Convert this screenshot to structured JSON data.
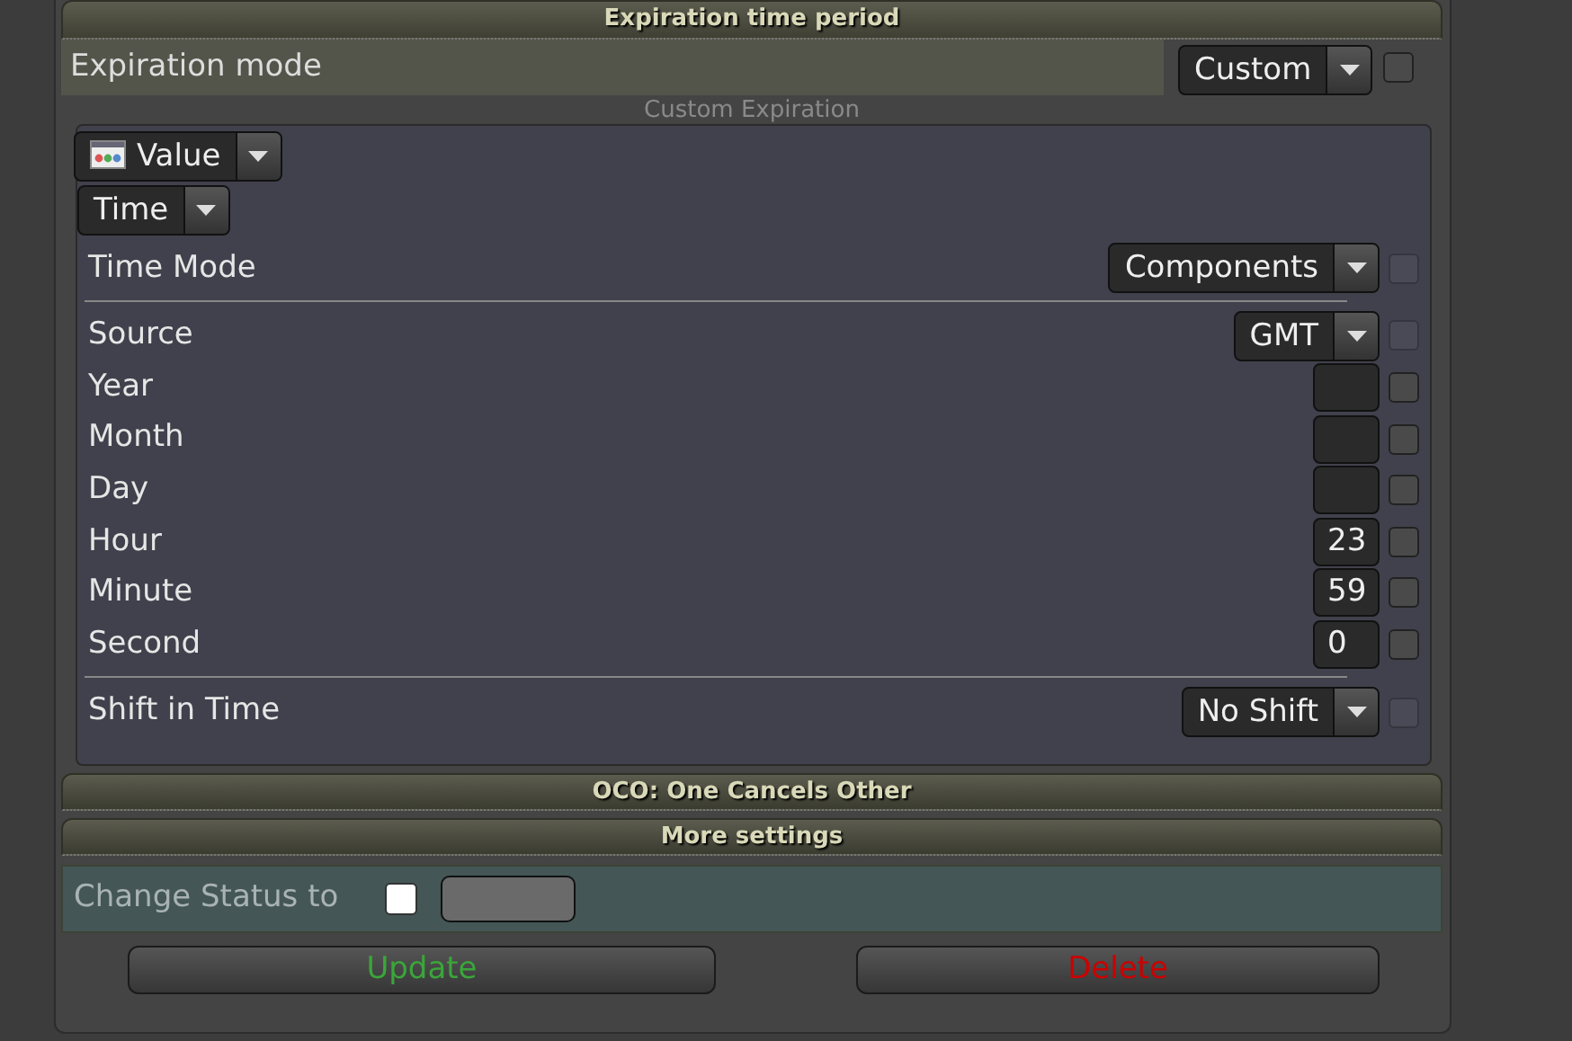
{
  "section_header": "Expiration time period",
  "expiration_mode": {
    "label": "Expiration mode",
    "value": "Custom",
    "checkbox": {
      "checked": false,
      "disabled": false
    }
  },
  "custom_expiration": {
    "caption": "Custom Expiration",
    "value_select": "Value",
    "type_select": "Time",
    "groups": [
      [
        {
          "kind": "select",
          "label": "Time Mode",
          "value": "Components",
          "checkbox": {
            "checked": false,
            "disabled": true
          }
        }
      ],
      [
        {
          "kind": "select",
          "label": "Source",
          "value": "GMT",
          "checkbox": {
            "checked": false,
            "disabled": true
          }
        },
        {
          "kind": "number",
          "label": "Year",
          "checkbox": {
            "checked": false,
            "disabled": false
          }
        },
        {
          "kind": "number",
          "label": "Month",
          "checkbox": {
            "checked": false,
            "disabled": false
          }
        },
        {
          "kind": "number",
          "label": "Day",
          "checkbox": {
            "checked": false,
            "disabled": false
          }
        },
        {
          "kind": "number",
          "label": "Hour",
          "value": "23",
          "checkbox": {
            "checked": false,
            "disabled": false
          }
        },
        {
          "kind": "number",
          "label": "Minute",
          "value": "59",
          "checkbox": {
            "checked": false,
            "disabled": false
          }
        },
        {
          "kind": "number",
          "label": "Second",
          "value": "0",
          "checkbox": {
            "checked": false,
            "disabled": false
          }
        }
      ],
      [
        {
          "kind": "select",
          "label": "Shift in Time",
          "value": "No Shift",
          "checkbox": {
            "checked": false,
            "disabled": true
          }
        }
      ]
    ]
  },
  "collapsed_sections": [
    "OCO: One Cancels Other",
    "More settings"
  ],
  "change_status": {
    "label": "Change Status to",
    "checked": false
  },
  "buttons": [
    {
      "label": "Update",
      "kind": "update"
    },
    {
      "label": "Delete",
      "kind": "delete"
    }
  ]
}
